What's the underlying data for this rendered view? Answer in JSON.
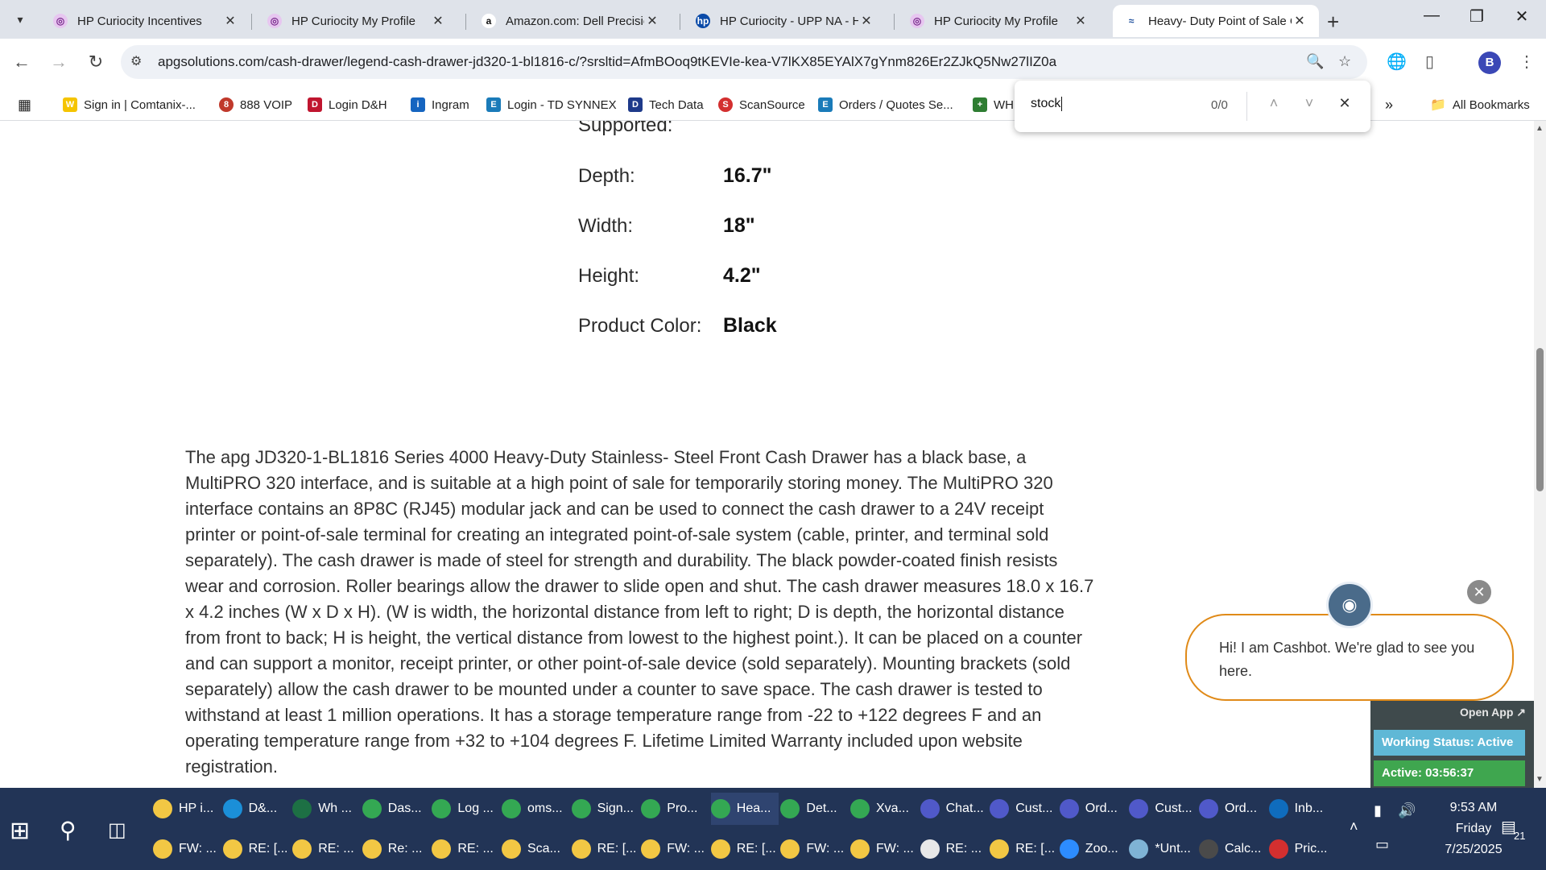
{
  "browser": {
    "tabs": [
      {
        "title": "HP Curiocity Incentives",
        "icon": "hp-curiocity-favicon",
        "active": false
      },
      {
        "title": "HP Curiocity My Profile",
        "icon": "hp-curiocity-favicon",
        "active": false
      },
      {
        "title": "Amazon.com: Dell Precisio",
        "icon": "amazon-favicon",
        "active": false
      },
      {
        "title": "HP Curiocity - UPP NA - H",
        "icon": "hp-favicon",
        "active": false
      },
      {
        "title": "HP Curiocity My Profile",
        "icon": "hp-curiocity-favicon",
        "active": false
      },
      {
        "title": "Heavy- Duty Point of Sale C",
        "icon": "apg-favicon",
        "active": true
      }
    ],
    "url": "apgsolutions.com/cash-drawer/legend-cash-drawer-jd320-1-bl1816-c/?srsltid=AfmBOoq9tKEVIe-kea-V7lKX85EYAlX7gYnm826Er2ZJkQ5Nw27lIZ0a",
    "profile_initial": "B",
    "bookmarks": [
      {
        "label": "Sign in | Comtanix-...",
        "icon": "w-icon",
        "color": "#f5c400"
      },
      {
        "label": "888 VOIP",
        "icon": "888-icon",
        "color": "#c0392b"
      },
      {
        "label": "Login D&H",
        "icon": "dh-icon",
        "color": "#c0152f"
      },
      {
        "label": "Ingram",
        "icon": "ingram-icon",
        "color": "#1565c0"
      },
      {
        "label": "Login - TD SYNNEX",
        "icon": "td-synnex-icon",
        "color": "#1a7bb9"
      },
      {
        "label": "Tech Data",
        "icon": "tech-data-icon",
        "color": "#1e3a8a"
      },
      {
        "label": "ScanSource",
        "icon": "scansource-icon",
        "color": "#d32f2f"
      },
      {
        "label": "Orders / Quotes Se...",
        "icon": "orders-icon",
        "color": "#1a7bb9"
      },
      {
        "label": "WH",
        "icon": "wh-icon",
        "color": "#2e7d32"
      }
    ],
    "all_bookmarks_label": "All Bookmarks",
    "find": {
      "query": "stock",
      "count": "0/0"
    }
  },
  "specs": [
    {
      "label": "Supported:",
      "value": ""
    },
    {
      "label": "Depth:",
      "value": "16.7\""
    },
    {
      "label": "Width:",
      "value": "18\""
    },
    {
      "label": "Height:",
      "value": "4.2\""
    },
    {
      "label": "Product Color:",
      "value": "Black"
    }
  ],
  "description": "The apg JD320-1-BL1816 Series 4000 Heavy-Duty Stainless- Steel Front Cash Drawer has a black base, a MultiPRO 320 interface, and is suitable at a high point of sale for temporarily storing money. The MultiPRO 320 interface contains an 8P8C (RJ45) modular jack and can be used to connect the cash drawer to a 24V receipt printer or point-of-sale terminal for creating an integrated point-of-sale system (cable, printer, and terminal sold separately). The cash drawer is made of steel for strength and durability. The black powder-coated finish resists wear and corrosion. Roller bearings allow the drawer to slide open and shut. The cash drawer measures 18.0 x 16.7 x 4.2 inches (W x D x H). (W is width, the horizontal distance from left to right; D is depth, the horizontal distance from front to back; H is height, the vertical distance from lowest to the highest point.). It can be placed on a counter and can support a monitor, receipt printer, or other point-of-sale device (sold separately). Mounting brackets (sold separately) allow the cash drawer to be mounted under a counter to save space. The cash drawer is tested to withstand at least 1 million operations. It has a storage temperature range from -22 to +122 degrees F and an operating temperature range from +32 to +104 degrees F. Lifetime Limited Warranty included upon website registration.",
  "chatbot": {
    "message": "Hi! I am Cashbot. We're glad to see you here.",
    "open_app": "Open App ↗",
    "working_status": "Working Status: Active",
    "active_time": "Active: 03:56:37"
  },
  "taskbar": {
    "row1": [
      {
        "label": "HP i...",
        "icon": "file-explorer-icon",
        "color": "#f2c744"
      },
      {
        "label": "D&...",
        "icon": "edge-icon",
        "color": "#1b8fd8"
      },
      {
        "label": "Wh ...",
        "icon": "excel-icon",
        "color": "#1d7044"
      },
      {
        "label": "Das...",
        "icon": "chrome-icon",
        "color": "#34a853"
      },
      {
        "label": "Log ...",
        "icon": "chrome-icon",
        "color": "#34a853"
      },
      {
        "label": "oms...",
        "icon": "chrome-icon",
        "color": "#34a853"
      },
      {
        "label": "Sign...",
        "icon": "chrome-icon",
        "color": "#34a853"
      },
      {
        "label": "Pro...",
        "icon": "chrome-icon",
        "color": "#34a853"
      },
      {
        "label": "Hea...",
        "icon": "chrome-icon",
        "color": "#34a853",
        "active": true
      },
      {
        "label": "Det...",
        "icon": "chrome-icon",
        "color": "#34a853"
      },
      {
        "label": "Xva...",
        "icon": "chrome-icon",
        "color": "#34a853"
      },
      {
        "label": "Chat...",
        "icon": "teams-icon",
        "color": "#5059c9"
      },
      {
        "label": "Cust...",
        "icon": "teams-icon",
        "color": "#5059c9"
      },
      {
        "label": "Ord...",
        "icon": "teams-icon",
        "color": "#5059c9"
      },
      {
        "label": "Cust...",
        "icon": "teams-icon",
        "color": "#5059c9"
      },
      {
        "label": "Ord...",
        "icon": "teams-icon",
        "color": "#5059c9"
      },
      {
        "label": "Inb...",
        "icon": "outlook-icon",
        "color": "#0f6cbd"
      }
    ],
    "row2": [
      {
        "label": "FW: ...",
        "icon": "mail-icon",
        "color": "#f2c744"
      },
      {
        "label": "RE: [...",
        "icon": "mail-icon",
        "color": "#f2c744"
      },
      {
        "label": "RE: ...",
        "icon": "mail-icon",
        "color": "#f2c744"
      },
      {
        "label": "Re: ...",
        "icon": "mail-icon",
        "color": "#f2c744"
      },
      {
        "label": "RE: ...",
        "icon": "mail-icon",
        "color": "#f2c744"
      },
      {
        "label": "Sca...",
        "icon": "mail-icon",
        "color": "#f2c744"
      },
      {
        "label": "RE: [...",
        "icon": "mail-icon",
        "color": "#f2c744"
      },
      {
        "label": "FW: ...",
        "icon": "mail-icon",
        "color": "#f2c744"
      },
      {
        "label": "RE: [...",
        "icon": "mail-icon",
        "color": "#f2c744"
      },
      {
        "label": "FW: ...",
        "icon": "mail-icon",
        "color": "#f2c744"
      },
      {
        "label": "FW: ...",
        "icon": "mail-icon",
        "color": "#f2c744"
      },
      {
        "label": "RE: ...",
        "icon": "mail-open-icon",
        "color": "#e8e8e8"
      },
      {
        "label": "RE: [...",
        "icon": "mail-icon",
        "color": "#f2c744"
      },
      {
        "label": "Zoo...",
        "icon": "zoom-icon",
        "color": "#2d8cff"
      },
      {
        "label": "*Unt...",
        "icon": "notepad-icon",
        "color": "#7fb3d5"
      },
      {
        "label": "Calc...",
        "icon": "calculator-icon",
        "color": "#4a4a4a"
      },
      {
        "label": "Pric...",
        "icon": "pdf-icon",
        "color": "#d32f2f"
      }
    ],
    "time": "9:53 AM",
    "day": "Friday",
    "date": "7/25/2025",
    "notifications": "21"
  }
}
